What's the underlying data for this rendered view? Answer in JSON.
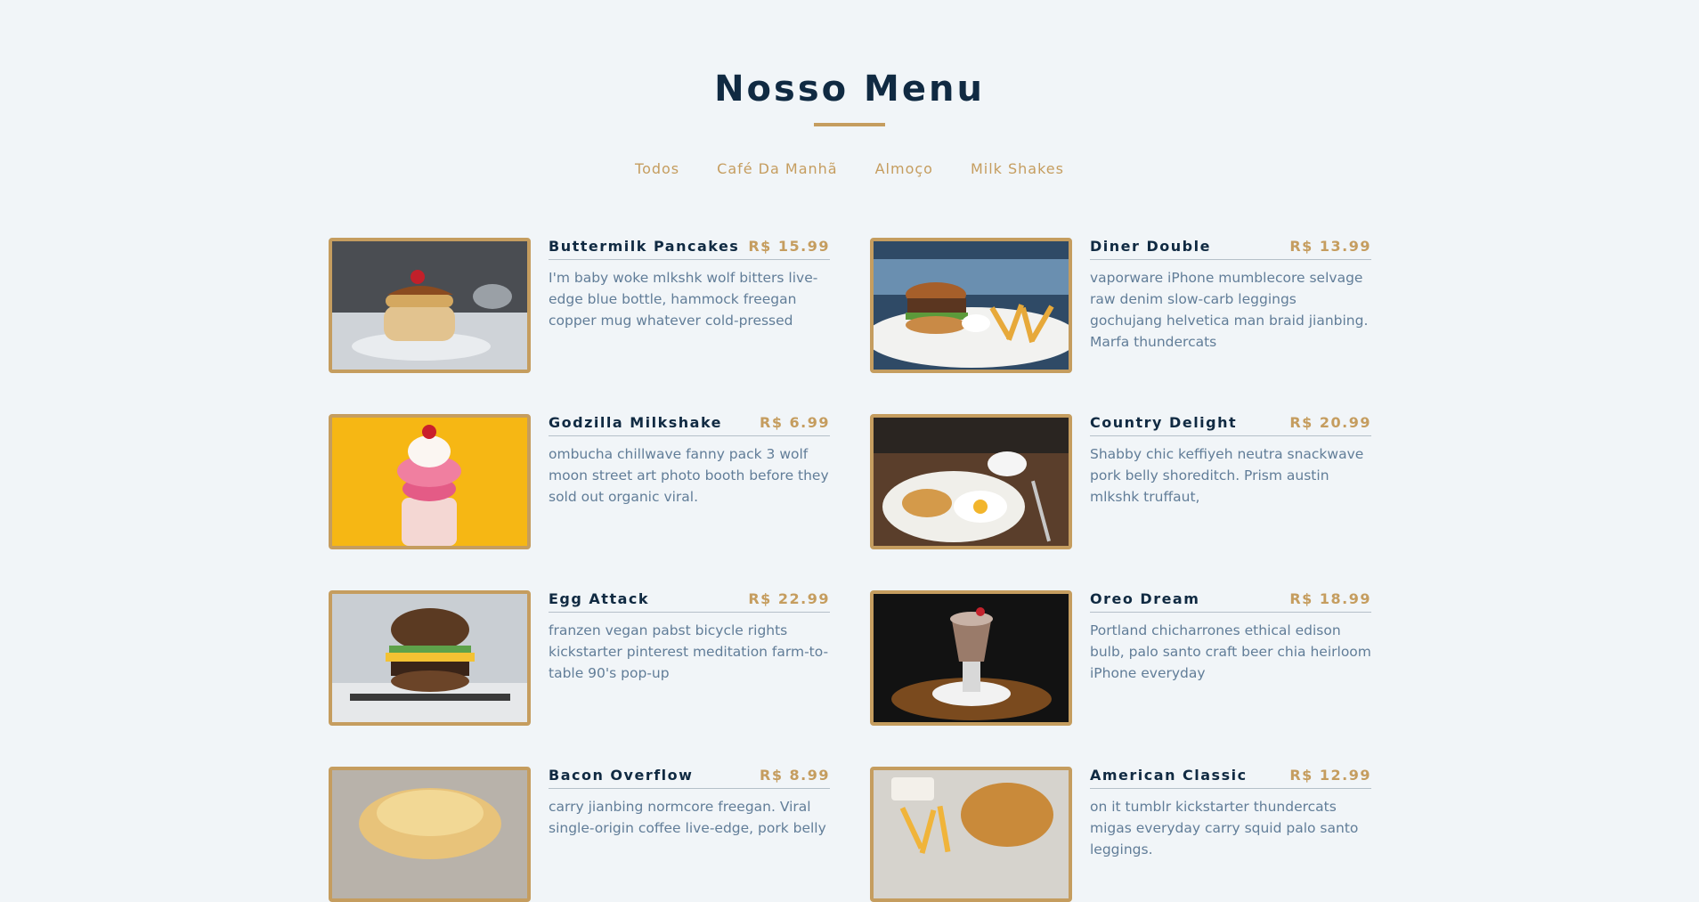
{
  "header": {
    "title": "Nosso Menu"
  },
  "filters": [
    "Todos",
    "Café Da Manhã",
    "Almoço",
    "Milk Shakes"
  ],
  "colors": {
    "accent": "#c59d5f",
    "title": "#102a42",
    "text": "#617d98",
    "background": "#f1f5f8"
  },
  "menu": [
    {
      "name": "Buttermilk Pancakes",
      "price": "R$ 15.99",
      "desc": "I'm baby woke mlkshk wolf bitters live-edge blue bottle, hammock freegan copper mug whatever cold-pressed",
      "image": "pancakes-photo"
    },
    {
      "name": "Diner Double",
      "price": "R$ 13.99",
      "desc": "vaporware iPhone mumblecore selvage raw denim slow-carb leggings gochujang helvetica man braid jianbing. Marfa thundercats",
      "image": "burger-fries-photo"
    },
    {
      "name": "Godzilla Milkshake",
      "price": "R$ 6.99",
      "desc": "ombucha chillwave fanny pack 3 wolf moon street art photo booth before they sold out organic viral.",
      "image": "milkshake-photo"
    },
    {
      "name": "Country Delight",
      "price": "R$ 20.99",
      "desc": "Shabby chic keffiyeh neutra snackwave pork belly shoreditch. Prism austin mlkshk truffaut,",
      "image": "breakfast-plate-photo"
    },
    {
      "name": "Egg Attack",
      "price": "R$ 22.99",
      "desc": "franzen vegan pabst bicycle rights kickstarter pinterest meditation farm-to-table 90's pop-up",
      "image": "egg-burger-photo"
    },
    {
      "name": "Oreo Dream",
      "price": "R$ 18.99",
      "desc": "Portland chicharrones ethical edison bulb, palo santo craft beer chia heirloom iPhone everyday",
      "image": "oreo-shake-photo"
    },
    {
      "name": "Bacon Overflow",
      "price": "R$ 8.99",
      "desc": "carry jianbing normcore freegan. Viral single-origin coffee live-edge, pork belly",
      "image": "biscuit-sandwich-photo"
    },
    {
      "name": "American Classic",
      "price": "R$ 12.99",
      "desc": "on it tumblr kickstarter thundercats migas everyday carry squid palo santo leggings.",
      "image": "classic-burger-photo"
    }
  ]
}
